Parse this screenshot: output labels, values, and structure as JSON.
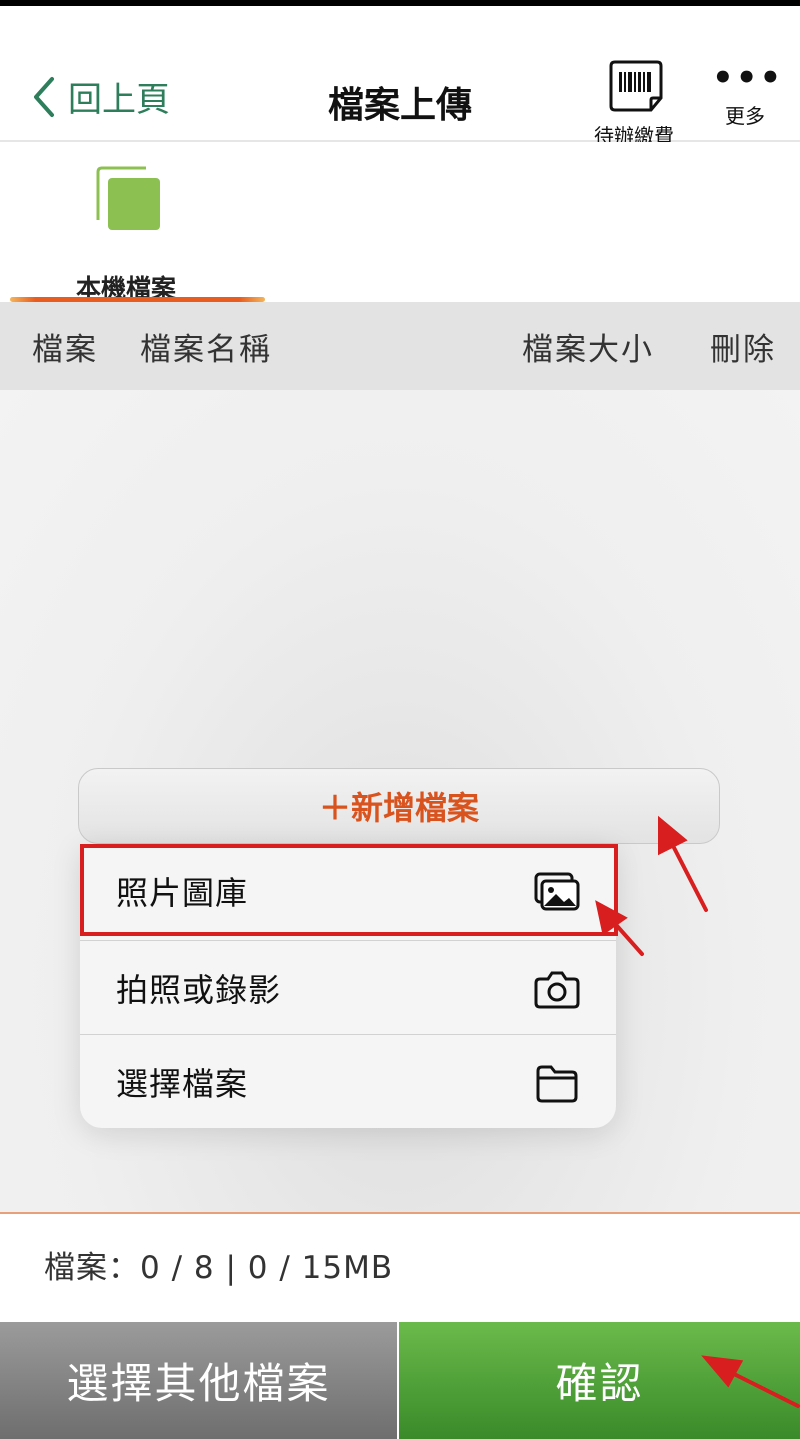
{
  "header": {
    "back_label": "回上頁",
    "title": "檔案上傳",
    "pending_label": "待辦繳費",
    "more_label": "更多",
    "more_glyph": "•••"
  },
  "source_tabs": {
    "local_label": "本機檔案"
  },
  "table": {
    "columns": [
      "檔案",
      "檔案名稱",
      "檔案大小",
      "刪除"
    ]
  },
  "add_file": {
    "label": "＋新增檔案"
  },
  "menu": {
    "items": [
      {
        "label": "照片圖庫",
        "icon": "photo-library-icon"
      },
      {
        "label": "拍照或錄影",
        "icon": "camera-icon"
      },
      {
        "label": "選擇檔案",
        "icon": "folder-icon"
      }
    ]
  },
  "summary": {
    "text": "檔案：0 / 8 | 0  /  15MB"
  },
  "buttons": {
    "other_label": "選擇其他檔案",
    "confirm_label": "確認"
  },
  "colors": {
    "accent_green": "#2e7d5b",
    "orange": "#d9531e",
    "highlight_red": "#d81e1e",
    "confirm_green": "#4e9e37"
  }
}
